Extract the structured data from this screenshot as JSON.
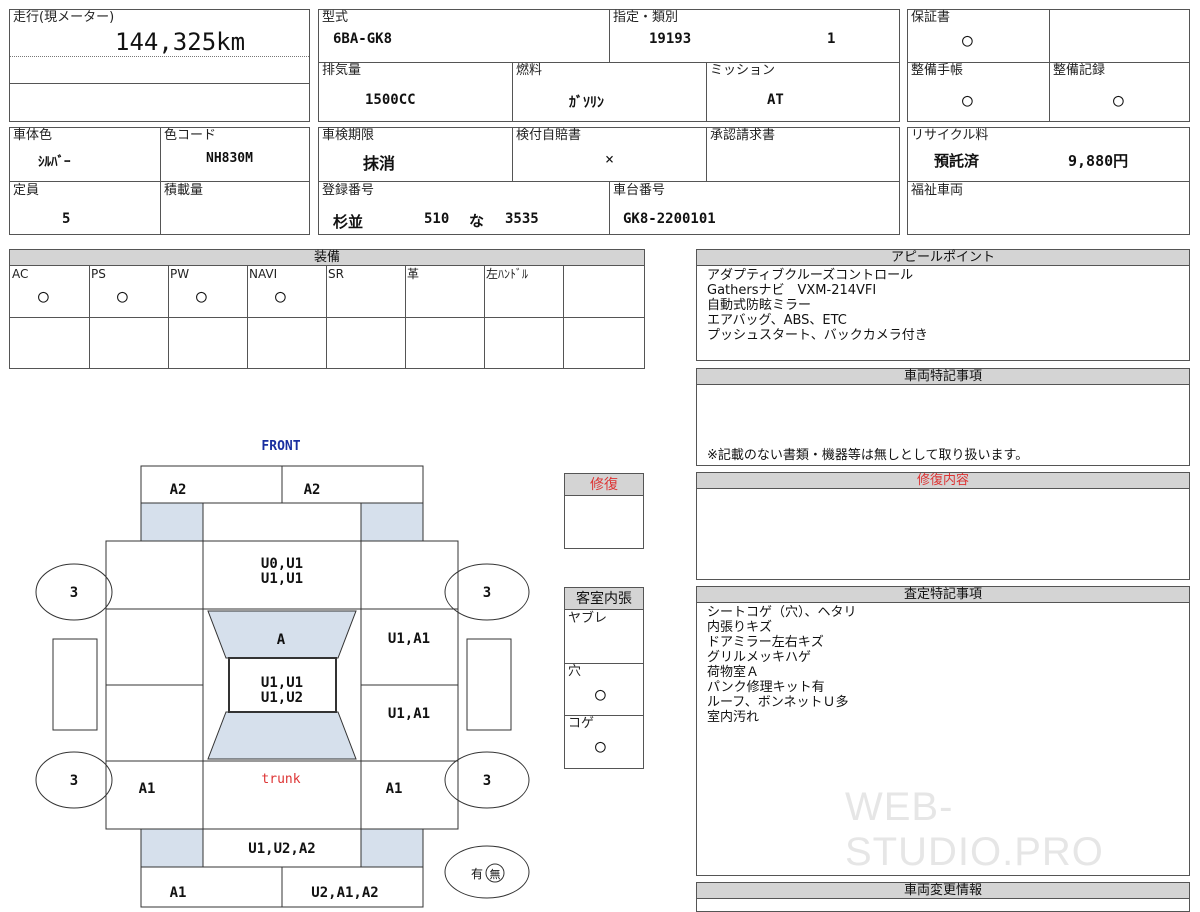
{
  "header": {
    "mileage_label": "走行(現メーター)",
    "mileage_value": "144,325km",
    "model_label": "型式",
    "model_value": "6BA-GK8",
    "designation_label": "指定・類別",
    "designation_value": "19193",
    "category_value": "1",
    "warranty_label": "保証書",
    "warranty_value": "○",
    "displacement_label": "排気量",
    "displacement_value": "1500CC",
    "fuel_label": "燃料",
    "fuel_value": "ｶﾞｿﾘﾝ",
    "transmission_label": "ミッション",
    "transmission_value": "AT",
    "maint_book_label": "整備手帳",
    "maint_book_value": "○",
    "maint_record_label": "整備記録",
    "maint_record_value": "○",
    "body_color_label": "車体色",
    "body_color_value": "ｼﾙﾊﾞｰ",
    "color_code_label": "色コード",
    "color_code_value": "NH830M",
    "inspection_label": "車検期限",
    "inspection_value": "抹消",
    "insurance_label": "検付自賠書",
    "insurance_value": "×",
    "approval_label": "承認請求書",
    "recycle_label": "リサイクル料",
    "recycle_status": "預託済",
    "recycle_amount": "9,880円",
    "capacity_label": "定員",
    "capacity_value": "5",
    "load_label": "積載量",
    "reg_label": "登録番号",
    "reg_area": "杉並",
    "reg_class": "510",
    "reg_kana": "な",
    "reg_number": "3535",
    "chassis_label": "車台番号",
    "chassis_value": "GK8-2200101",
    "welfare_label": "福祉車両"
  },
  "equipment": {
    "title": "装備",
    "columns": [
      "AC",
      "PS",
      "PW",
      "NAVI",
      "SR",
      "革",
      "左ﾊﾝﾄﾞﾙ"
    ],
    "marks": [
      "○",
      "○",
      "○",
      "○",
      "",
      "",
      ""
    ]
  },
  "appeal": {
    "title": "アピールポイント",
    "lines": [
      "アダプティブクルーズコントロール",
      "Gathersナビ　VXM-214VFI",
      "自動式防眩ミラー",
      "エアバッグ、ABS、ETC",
      "プッシュスタート、バックカメラ付き"
    ]
  },
  "vehicle_notes": {
    "title": "車両特記事項",
    "note": "※記載のない書類・機器等は無しとして取り扱います。"
  },
  "repair_content": {
    "title": "修復内容"
  },
  "assessment": {
    "title": "査定特記事項",
    "lines": [
      "シートコゲ（穴）、ヘタリ",
      "内張りキズ",
      "ドアミラー左右キズ",
      "グリルメッキハゲ",
      "荷物室Ａ",
      "パンク修理キット有",
      "ルーフ、ボンネットＵ多",
      "室内汚れ"
    ]
  },
  "change_info": {
    "title": "車両変更情報"
  },
  "repair": {
    "title": "修復"
  },
  "interior": {
    "title": "客室内張",
    "items": [
      {
        "label": "ヤブレ",
        "mark": ""
      },
      {
        "label": "穴",
        "mark": "○"
      },
      {
        "label": "コゲ",
        "mark": "○"
      }
    ]
  },
  "diagram": {
    "front": "FRONT",
    "trunk": "trunk",
    "front_left": "A2",
    "front_right": "A2",
    "hood": "U0,U1\nU1,U1",
    "windshield": "A",
    "roof": "U1,U1\nU1,U2",
    "right_front_door": "U1,A1",
    "right_rear_door": "U1,A1",
    "left_rear_quarter": "A1",
    "right_rear_quarter": "A1",
    "rear_panel": "U1,U2,A2",
    "rear_left": "A1",
    "rear_right": "U2,A1,A2",
    "tires": [
      "3",
      "3",
      "3",
      "3"
    ],
    "spare_yes": "有",
    "spare_no": "無"
  },
  "watermark": "WEB-STUDIO.PRO"
}
